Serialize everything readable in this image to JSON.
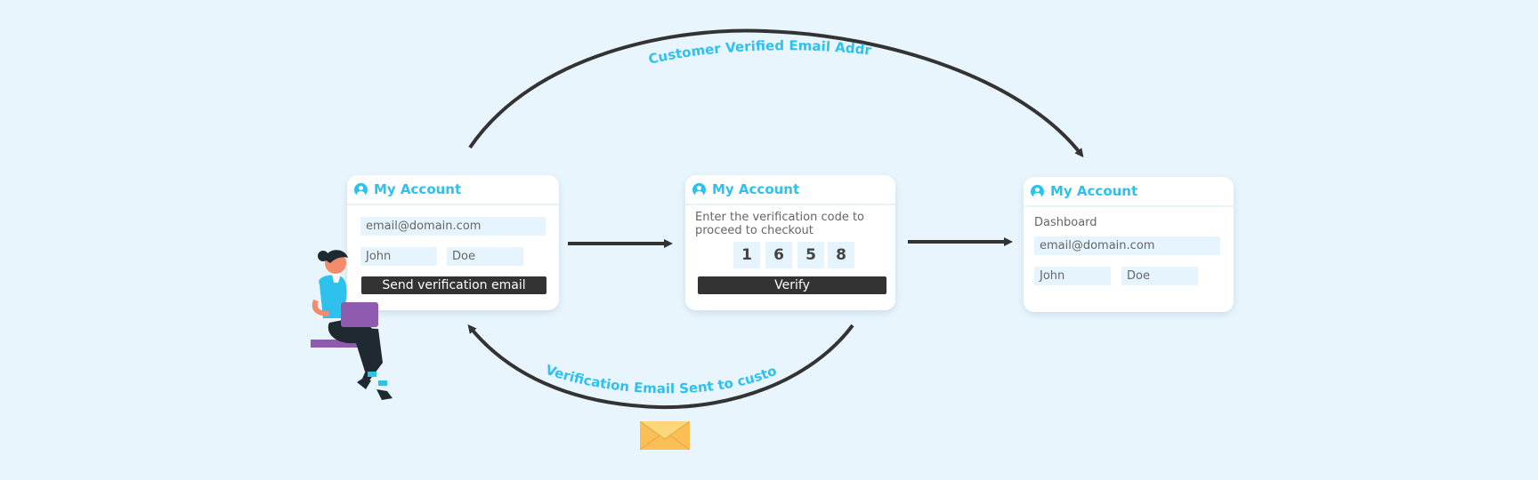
{
  "colors": {
    "background": "#e8f5fd",
    "accent": "#2ec1ee",
    "dark": "#333333",
    "field": "#e6f4fd",
    "envelope": "#fbbf55"
  },
  "flow_labels": {
    "top": "Customer Verified Email Address",
    "bottom": "Verification Email Sent to customer"
  },
  "cards": [
    {
      "title": "My Account",
      "icon": "user-circle-icon",
      "email": "email@domain.com",
      "first_name": "John",
      "last_name": "Doe",
      "button": "Send verification email"
    },
    {
      "title": "My Account",
      "icon": "user-circle-icon",
      "instruction": "Enter the verification code to proceed to checkout",
      "code": [
        "1",
        "6",
        "5",
        "8"
      ],
      "button": "Verify"
    },
    {
      "title": "My Account",
      "icon": "user-circle-icon",
      "section": "Dashboard",
      "email": "email@domain.com",
      "first_name": "John",
      "last_name": "Doe"
    }
  ],
  "icons": {
    "envelope": "envelope-icon",
    "person": "woman-with-laptop-illustration"
  }
}
